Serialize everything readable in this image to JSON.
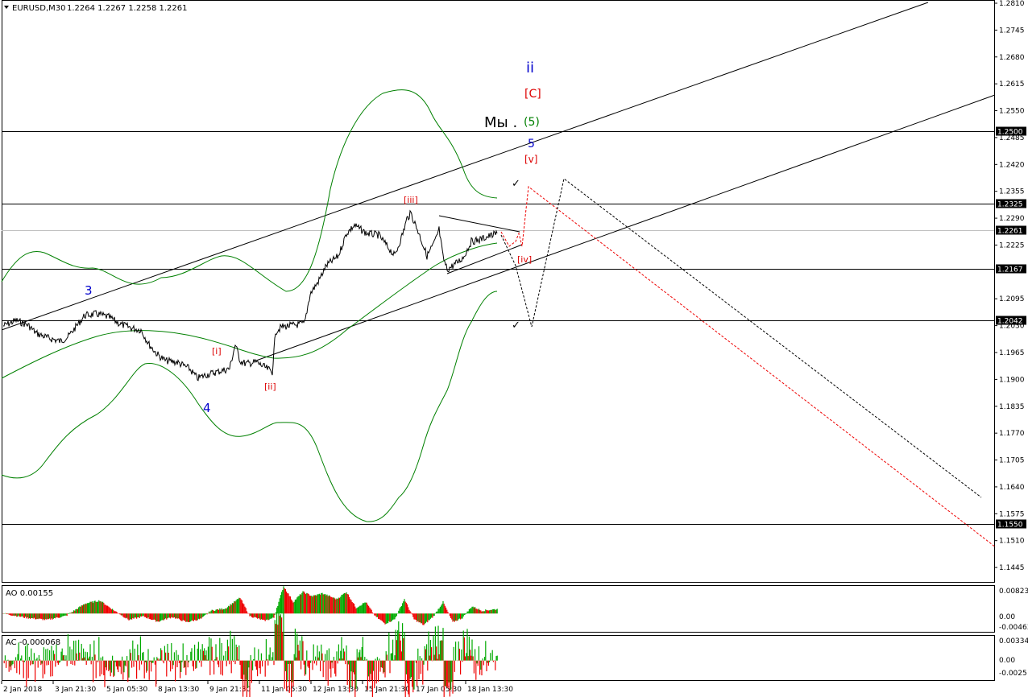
{
  "chart_data": {
    "type": "line",
    "symbol": "EURUSD,M30",
    "quote": "1.2264 1.2267 1.2258 1.2261",
    "price_axis": {
      "ylim": [
        1.1414,
        1.281
      ],
      "ticks": [
        "1.2810",
        "1.2745",
        "1.2680",
        "1.2615",
        "1.2550",
        "1.2485",
        "1.2420",
        "1.2355",
        "1.2290",
        "1.2225",
        "1.2095",
        "1.2030",
        "1.1965",
        "1.1900",
        "1.1835",
        "1.1770",
        "1.1705",
        "1.1640",
        "1.1575",
        "1.1510",
        "1.1445"
      ]
    },
    "x_labels": [
      "2 Jan 2018",
      "3 Jan 21:30",
      "5 Jan 05:30",
      "8 Jan 13:30",
      "9 Jan 21:30",
      "11 Jan 05:30",
      "12 Jan 13:30",
      "15 Jan 21:30",
      "17 Jan 05:30",
      "18 Jan 13:30"
    ],
    "levels": [
      {
        "value": 1.25,
        "label": "1.2500"
      },
      {
        "value": 1.2325,
        "label": "1.2325"
      },
      {
        "value": 1.2167,
        "label": "1.2167"
      },
      {
        "value": 1.2042,
        "label": "1.2042"
      },
      {
        "value": 1.155,
        "label": "1.1550"
      }
    ],
    "current_price": {
      "value": 1.2261,
      "label": "1.2261"
    },
    "wave_labels": [
      {
        "text": "ii",
        "color": "#0000cc"
      },
      {
        "text": "[C]",
        "color": "#dd0000"
      },
      {
        "text": "Мы .",
        "color": "#000000"
      },
      {
        "text": "(5)",
        "color": "#008000"
      },
      {
        "text": "5",
        "color": "#0000cc"
      },
      {
        "text": "[v]",
        "color": "#dd0000"
      },
      {
        "text": "[iii]",
        "color": "#dd0000"
      },
      {
        "text": "[iv]",
        "color": "#dd0000"
      },
      {
        "text": "3",
        "color": "#0000cc"
      },
      {
        "text": "[i]",
        "color": "#dd0000"
      },
      {
        "text": "[ii]",
        "color": "#dd0000"
      },
      {
        "text": "4",
        "color": "#0000cc"
      },
      {
        "text": "✓",
        "color": "#000000"
      },
      {
        "text": "✓",
        "color": "#000000"
      }
    ],
    "ao": {
      "label": "AO 0.00155",
      "ticks": [
        "0.00823",
        "0.00",
        "-0.00463"
      ],
      "ylim": [
        -0.0055,
        0.009
      ]
    },
    "ac": {
      "label": "AC -0.000068",
      "ticks": [
        "0.003348",
        "0.00",
        "-0.0025"
      ],
      "ylim": [
        -0.0028,
        0.0036
      ]
    },
    "colors": {
      "up": "#00aa00",
      "down": "#ee0000",
      "bands": "#008000",
      "path_black": "#000000",
      "path_red": "#ee0000"
    }
  }
}
